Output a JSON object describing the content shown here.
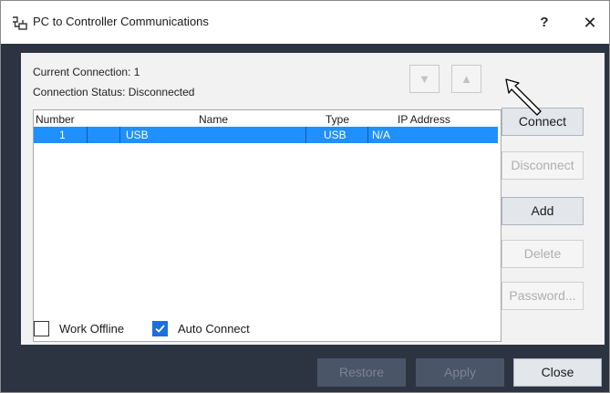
{
  "window": {
    "title": "PC to Controller Communications",
    "help_label": "?",
    "close_glyph": "✕"
  },
  "info": {
    "current_connection": "Current Connection: 1",
    "connection_status": "Connection Status: Disconnected"
  },
  "move_buttons": {
    "down": "▼",
    "up": "▲"
  },
  "table": {
    "columns": [
      "Number",
      "Name",
      "Type",
      "IP Address"
    ],
    "rows": [
      {
        "number": "1",
        "name": "USB",
        "type": "USB",
        "ip_address": "N/A",
        "selected": true
      }
    ]
  },
  "side_buttons": {
    "connect": "Connect",
    "disconnect": "Disconnect",
    "add": "Add",
    "delete": "Delete",
    "password": "Password..."
  },
  "checkboxes": {
    "work_offline": {
      "label": "Work Offline",
      "checked": false
    },
    "auto_connect": {
      "label": "Auto Connect",
      "checked": true
    }
  },
  "footer": {
    "restore": "Restore",
    "apply": "Apply",
    "close": "Close"
  },
  "colors": {
    "selection": "#1e90ff",
    "checkbox_checked": "#1e6fdc",
    "frame": "#2c3442"
  }
}
